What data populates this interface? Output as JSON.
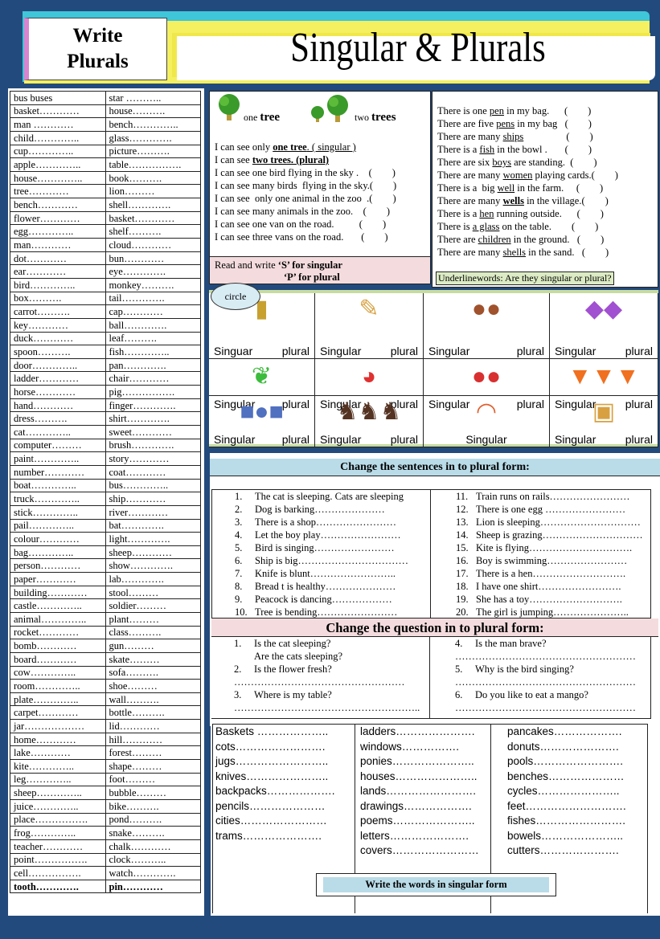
{
  "header": {
    "side_title_line1": "Write",
    "side_title_line2": "Plurals",
    "title": "Singular & Plurals"
  },
  "word_table": [
    [
      "bus    buses",
      "star ……….."
    ],
    [
      "basket…………",
      "house………."
    ],
    [
      "man   …………",
      "bench………….."
    ],
    [
      "child…………..",
      "glass…………."
    ],
    [
      "cup…………..",
      "picture………."
    ],
    [
      "apple…………..",
      "table……………."
    ],
    [
      "house…………..",
      "book………."
    ],
    [
      "tree…………",
      "lion………"
    ],
    [
      "bench…………",
      "shell…………."
    ],
    [
      "flower…………",
      "basket…………"
    ],
    [
      "egg…………..",
      "shelf………."
    ],
    [
      "man…………",
      "cloud…………"
    ],
    [
      "dot…………",
      "bun…………"
    ],
    [
      "ear…………",
      "eye…………."
    ],
    [
      "bird…………..",
      "monkey………."
    ],
    [
      "box……….",
      "tail…………."
    ],
    [
      "carrot……….",
      "cap…………"
    ],
    [
      "key…………",
      "ball…………."
    ],
    [
      "duck…………",
      "leaf………."
    ],
    [
      "spoon……….",
      "fish………….."
    ],
    [
      "door…………..",
      "pan…………."
    ],
    [
      "ladder…………",
      "chair…………"
    ],
    [
      "horse…………",
      "pig……………."
    ],
    [
      "hand…………",
      "finger…………."
    ],
    [
      "dress……….",
      "shirt…………."
    ],
    [
      "cat…………..",
      "sweet…………"
    ],
    [
      "computer………",
      "brush…………."
    ],
    [
      "paint…………..",
      "story…………"
    ],
    [
      "number…………",
      "coat…………"
    ],
    [
      "boat…………..",
      "bus………….."
    ],
    [
      "truck…………..",
      "ship…………"
    ],
    [
      "stick…………..",
      "river…………"
    ],
    [
      "pail…………..",
      "bat…………."
    ],
    [
      "colour…………",
      "light…………."
    ],
    [
      "bag…………..",
      "sheep…………"
    ],
    [
      "person…………",
      "show…………."
    ],
    [
      "paper…………",
      "lab…………."
    ],
    [
      "building…………",
      "stool………"
    ],
    [
      "castle…………..",
      "soldier………"
    ],
    [
      "animal…………..",
      "plant………"
    ],
    [
      "rocket…………",
      "class………."
    ],
    [
      "bomb…………",
      "gun………"
    ],
    [
      "board…………",
      "skate………"
    ],
    [
      "cow…………..",
      "sofa………."
    ],
    [
      "room…………..",
      "shoe………"
    ],
    [
      "plate…………..",
      "wall………."
    ],
    [
      "carpet…………",
      "bottle………."
    ],
    [
      "jar………………",
      "lid…………"
    ],
    [
      "home…………",
      "hill…………"
    ],
    [
      "lake…………",
      "forest………"
    ],
    [
      "kite…………..",
      "shape………"
    ],
    [
      "leg…………..",
      "foot………"
    ],
    [
      "sheep…………..",
      "bubble………"
    ],
    [
      "juice…………..",
      "bike………."
    ],
    [
      "place…………….",
      "pond………."
    ],
    [
      "frog…………..",
      "snake………."
    ],
    [
      "teacher…………",
      "chalk…………"
    ],
    [
      "point…………….",
      "clock……….."
    ],
    [
      "cell…………….",
      "watch…………."
    ],
    [
      "tooth………….",
      "pin…………"
    ]
  ],
  "section1": {
    "one_tree": {
      "pre": "one",
      "word": "tree"
    },
    "two_trees": {
      "pre": "two",
      "word": "trees"
    },
    "sentences": [
      [
        {
          "t": "I can see only "
        },
        {
          "t": "one tree",
          "u": 1,
          "b": 1
        },
        {
          "t": ". ( singular )",
          "u": 1
        }
      ],
      [
        {
          "t": "I can see "
        },
        {
          "t": "two trees. (plural)",
          "u": 1,
          "b": 1
        }
      ],
      [
        {
          "t": "I can see one bird flying in the sky .    (        )"
        }
      ],
      [
        {
          "t": "I can see many birds  flying in the sky.(        )"
        }
      ],
      [
        {
          "t": "I can see  only one animal in the zoo  .(        )"
        }
      ],
      [
        {
          "t": "I can see many animals in the zoo.    (        )"
        }
      ],
      [
        {
          "t": "I can see one van on the road.          (        )"
        }
      ],
      [
        {
          "t": "I can see three vans on the road.       (        )"
        }
      ]
    ],
    "instruction_line1_pre": "Read and write ",
    "instruction_line1_bold": "‘S’ for singular",
    "instruction_line2_bold": "‘P’ for plural"
  },
  "section2": {
    "sentences": [
      [
        {
          "t": "There is one "
        },
        {
          "t": "pen",
          "u": 1
        },
        {
          "t": " in my bag.      (        )"
        }
      ],
      [
        {
          "t": "There are five "
        },
        {
          "t": "pens",
          "u": 1
        },
        {
          "t": " in my bag   (        )"
        }
      ],
      [
        {
          "t": "There are many "
        },
        {
          "t": "ships",
          "u": 1
        },
        {
          "t": "                 (        )"
        }
      ],
      [
        {
          "t": "There is a "
        },
        {
          "t": "fish",
          "u": 1
        },
        {
          "t": " in the bowl .       (        )"
        }
      ],
      [
        {
          "t": "There are six "
        },
        {
          "t": "boys",
          "u": 1
        },
        {
          "t": " are standing.  (        )"
        }
      ],
      [
        {
          "t": "There are many "
        },
        {
          "t": "women",
          "u": 1
        },
        {
          "t": " playing cards.(        )"
        }
      ],
      [
        {
          "t": "There is a  big "
        },
        {
          "t": "well",
          "u": 1
        },
        {
          "t": " in the farm.     (        )"
        }
      ],
      [
        {
          "t": "There are many "
        },
        {
          "t": "wells",
          "u": 1,
          "b": 1
        },
        {
          "t": " in the village.(        )"
        }
      ],
      [
        {
          "t": "There is a "
        },
        {
          "t": "hen",
          "u": 1
        },
        {
          "t": " running outside.      (        )"
        }
      ],
      [
        {
          "t": "There is "
        },
        {
          "t": "a glass",
          "u": 1
        },
        {
          "t": " on the table.        (        )"
        }
      ],
      [
        {
          "t": "There are "
        },
        {
          "t": "children",
          "u": 1
        },
        {
          "t": " in the ground.   (        )"
        }
      ],
      [
        {
          "t": "There are many "
        },
        {
          "t": "shells",
          "u": 1
        },
        {
          "t": " in the sand.   (        )"
        }
      ]
    ],
    "instruction": "Underlinewords: Are they singular or plural?"
  },
  "picture_grid": {
    "circle_label": "circle",
    "cells": [
      {
        "image": "door-icon",
        "labels": [
          "Singuar",
          "plural"
        ]
      },
      {
        "image": "pencil-icon",
        "labels": [
          "Singular",
          "plural"
        ]
      },
      {
        "image": "cow-icon",
        "labels": [
          "Singular",
          "plural"
        ]
      },
      {
        "image": "fish-icon",
        "labels": [
          "Singular",
          "plural"
        ]
      },
      {
        "image": "leaf-icon",
        "labels": [
          "Singular",
          "plural"
        ]
      },
      {
        "image": "ball-icon",
        "labels": [
          "Singular",
          "plural"
        ]
      },
      {
        "image": "apples-icon",
        "labels": [
          "Singular",
          "plural"
        ]
      },
      {
        "image": "carrots-icon",
        "labels": [
          "Singular",
          "plural"
        ]
      },
      {
        "image": "shapes-icon",
        "labels": [
          "Singular",
          "plural"
        ]
      },
      {
        "image": "cats-icon",
        "labels": [
          "Singular",
          "plural"
        ]
      },
      {
        "image": "rainbow-icon",
        "labels": [
          "Singular"
        ]
      },
      {
        "image": "portrait-icon",
        "labels": [
          "Singular",
          "plural"
        ]
      }
    ]
  },
  "change_sentences": {
    "title": "Change the sentences in to plural form:",
    "left": [
      "The cat is sleeping. Cats are sleeping",
      "Dog is barking…………………",
      "There is a shop……………………",
      "Let the boy play……………………",
      "Bird is singing……………………",
      "Ship is big……………………………",
      "Knife is blunt……………………..",
      "Bread t is healthy…………………",
      "Peacock is dancing………………",
      "Tree is bending……………………"
    ],
    "right": [
      "Train  runs on rails……………………",
      "There is one egg ……………………",
      "Lion is sleeping…………………………",
      "Sheep is grazing…………………………",
      "Kite is flying………………………….",
      "Boy is swimming……………………",
      "There is a hen……………………….",
      "I have  one shirt…………………….",
      "She has a toy……………………….",
      "The girl is jumping………………….."
    ]
  },
  "change_questions": {
    "title": "Change the question in to plural form:",
    "left": [
      {
        "n": "1.",
        "q": "Is the cat sleeping?",
        "a": "Are the cats sleeping?"
      },
      {
        "n": "2.",
        "q": "Is the flower  fresh?",
        "a": "……………………………………………"
      },
      {
        "n": "3.",
        "q": "Where is my table?",
        "a": "……………………………………………….."
      }
    ],
    "right": [
      {
        "n": "4.",
        "q": "Is the man brave?",
        "a": "………………………………………………"
      },
      {
        "n": "5.",
        "q": "Why is the bird singing?",
        "a": "………………………………………………"
      },
      {
        "n": "6.",
        "q": "Do you like to eat a mango?",
        "a": "………………………………………………"
      }
    ]
  },
  "singular_words": {
    "columns": [
      [
        "Baskets ………………..",
        "cots…………………….",
        "jugs……………………..",
        "knives…………………..",
        "backpacks……………….",
        "pencils…………………",
        "cities……………………",
        "trams…………………."
      ],
      [
        "ladders………………….",
        "windows…………….",
        "ponies…………………..",
        "houses…………………..",
        "lands…………………….",
        "drawings……………….",
        "poems…………………..",
        "letters………………….",
        "covers……………………"
      ],
      [
        "pancakes……………….",
        "donuts………………….",
        "pools…………………….",
        "benches…………………",
        "cycles…………………..",
        "feet……………………….",
        "fishes…………………….",
        "bowels…………………..",
        "cutters…………………."
      ]
    ],
    "instruction": "Write the words in singular form"
  },
  "colors": {
    "background": "#234a7c",
    "header_cyan": "#3fc6d8",
    "header_yellow": "#f4f060",
    "pink_band": "#f4dcde",
    "blue_band": "#b9dce8",
    "green_band": "#c7dca0"
  }
}
